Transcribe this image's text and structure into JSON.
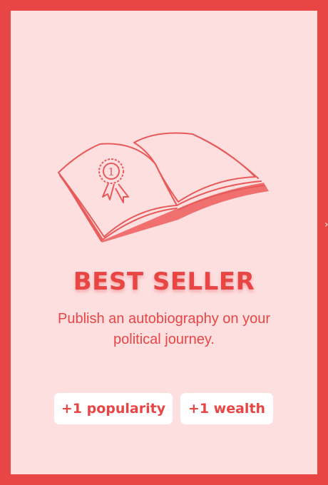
{
  "card": {
    "title": "BEST SELLER",
    "description": "Publish an autobiography on your political journey.",
    "rewards": [
      {
        "label": "+1 popularity"
      },
      {
        "label": "+1 wealth"
      }
    ],
    "badge_number": "1"
  },
  "colors": {
    "accent": "#e84545",
    "card_background": "#fddfe0",
    "badge_background": "#ffffff"
  },
  "icons": {
    "illustration": "open-book-with-award-ribbon-icon"
  }
}
